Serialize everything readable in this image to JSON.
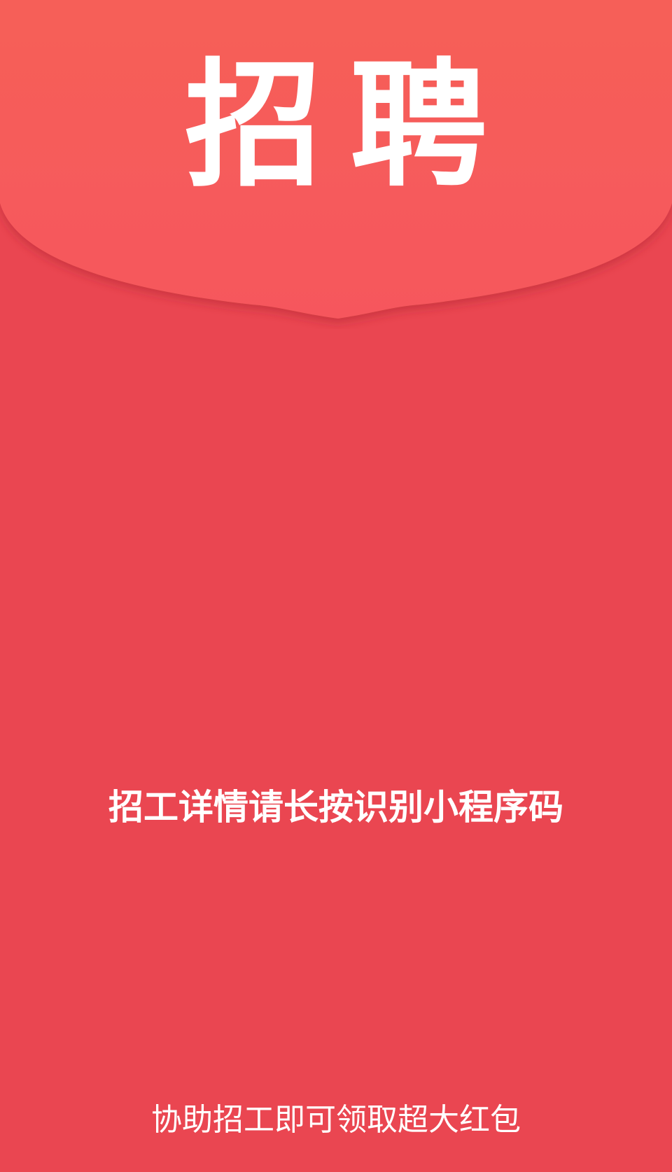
{
  "envelope": {
    "title": "招聘",
    "instruction": "招工详情请长按识别小程序码",
    "footer": "协助招工即可领取超大红包"
  },
  "colors": {
    "body": "#ea4651",
    "flap_top": "#f65f58",
    "flap_bottom": "#f6585d",
    "text": "#ffffff"
  }
}
